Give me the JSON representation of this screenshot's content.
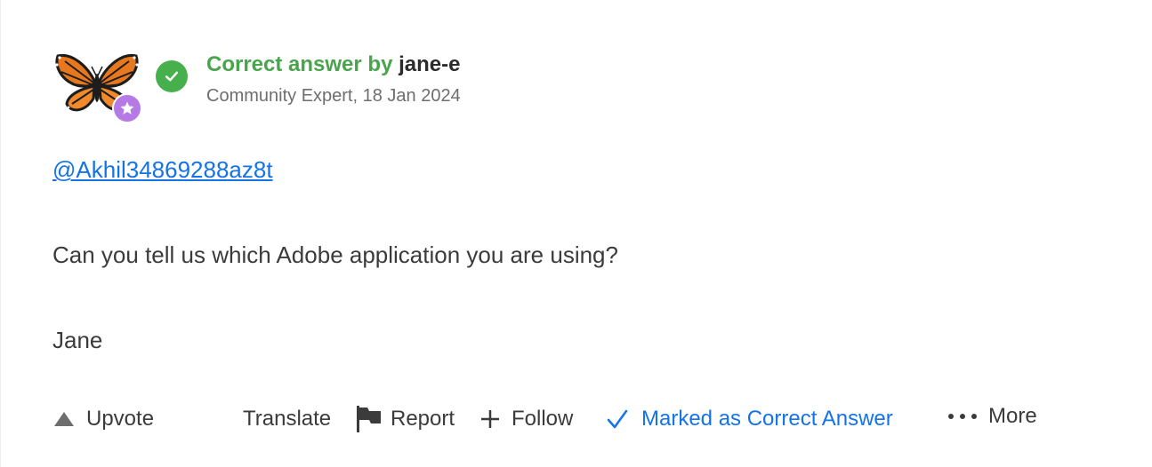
{
  "post": {
    "correct_prefix": "Correct answer by",
    "author": "jane-e",
    "meta": "Community Expert, 18 Jan 2024",
    "mention": "@Akhil34869288az8t",
    "question": "Can you tell us which Adobe application you are using?",
    "signature": "Jane"
  },
  "actions": {
    "upvote": "Upvote",
    "translate": "Translate",
    "report": "Report",
    "follow": "Follow",
    "marked": "Marked as Correct Answer",
    "more": "More"
  },
  "icons": {
    "avatar": "butterfly-avatar",
    "expert_badge": "star-badge-icon",
    "correct_badge": "check-circle-icon",
    "upvote": "triangle-up-icon",
    "report": "flag-icon",
    "follow": "plus-icon",
    "marked": "checkmark-icon",
    "more": "ellipsis-icon"
  },
  "colors": {
    "correct_green": "#48a54c",
    "badge_green": "#45b04c",
    "link_blue": "#1473e6",
    "expert_purple": "#b57ae6",
    "text": "#3b3b3b",
    "meta_gray": "#6e6e6e"
  }
}
